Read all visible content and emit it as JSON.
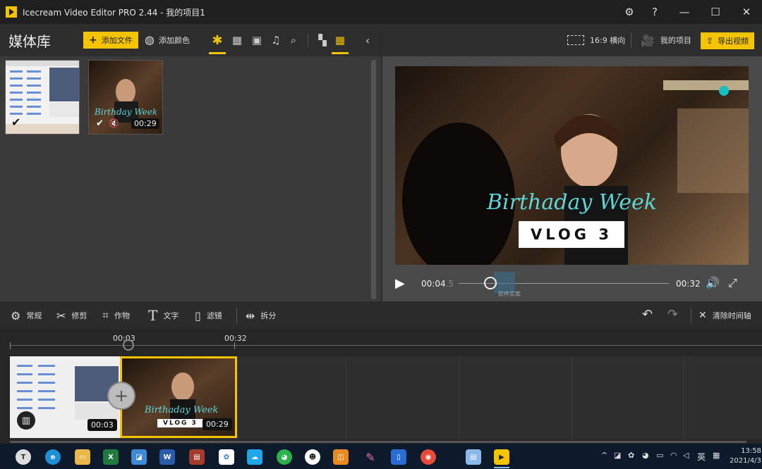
{
  "window": {
    "title": "Icecream Video Editor PRO 2.44  -  我的项目1"
  },
  "library": {
    "title": "媒体库",
    "add_file": "添加文件",
    "add_color": "添加颜色",
    "thumbs": [
      {
        "duration": ""
      },
      {
        "overlay_text": "Birthday Week",
        "duration": "00:29"
      }
    ]
  },
  "preview": {
    "aspect": "16:9 横向",
    "my_projects": "我的项目",
    "export": "导出视频",
    "video_title": "Birthaday Week",
    "vlog": "VLOG 3",
    "time_current": "00:04",
    "time_current_sub": ".5",
    "time_total": "00:32",
    "watermark": "软件实库",
    "playhead_fraction": 0.14
  },
  "edit_toolbar": {
    "general": "常规",
    "trim": "修剪",
    "crop": "作物",
    "text": "文字",
    "filter": "滤镜",
    "split": "拆分",
    "clear_timeline": "清除时间轴"
  },
  "timeline": {
    "marker1": "00:03",
    "marker2": "00:32",
    "clips": [
      {
        "duration": "00:03"
      },
      {
        "overlay_title": "Birthaday Week",
        "overlay_vlog": "VLOG 3",
        "duration": "00:29"
      }
    ]
  },
  "taskbar": {
    "ime": "英",
    "time": "13:58",
    "date": "2021/4/3"
  },
  "colors": {
    "accent": "#f5c400",
    "title_cyan": "#5ed6d8"
  }
}
